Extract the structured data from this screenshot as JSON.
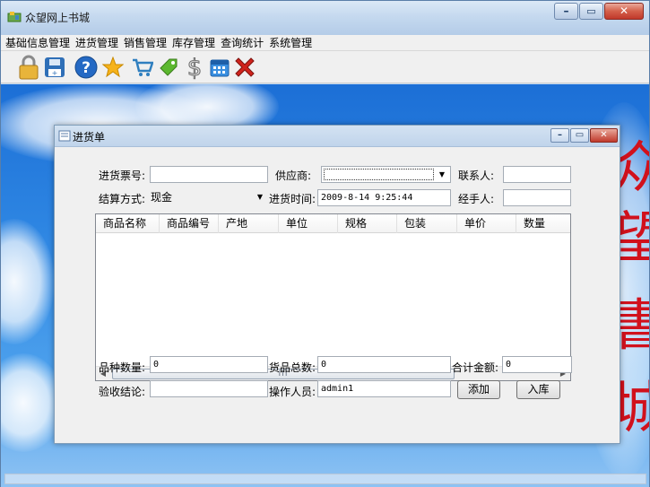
{
  "app": {
    "title": "众望网上书城"
  },
  "menu": [
    "基础信息管理",
    "进货管理",
    "销售管理",
    "库存管理",
    "查询统计",
    "系统管理"
  ],
  "toolbar_icons": [
    "lock-icon",
    "floppy-icon",
    "help-icon",
    "star-icon",
    "cart-icon",
    "tag-icon",
    "dollar-icon",
    "calendar-icon",
    "exit-icon"
  ],
  "brush_text": [
    "众",
    "望",
    "書",
    "城"
  ],
  "dialog": {
    "title": "进货单",
    "labels": {
      "ticket_no": "进货票号:",
      "supplier": "供应商:",
      "contact": "联系人:",
      "settlement": "结算方式:",
      "time": "进货时间:",
      "handler": "经手人:",
      "kinds": "品种数量:",
      "total_qty": "货品总数:",
      "total_amount": "合计金额:",
      "conclusion": "验收结论:",
      "operator": "操作人员:"
    },
    "values": {
      "ticket_no": "",
      "supplier": "",
      "contact": "",
      "settlement": "现金",
      "time": "2009-8-14 9:25:44",
      "handler": "",
      "kinds": "0",
      "total_qty": "0",
      "total_amount": "0",
      "conclusion": "",
      "operator": "admin1"
    },
    "columns": [
      "商品名称",
      "商品编号",
      "产地",
      "单位",
      "规格",
      "包装",
      "单价",
      "数量"
    ],
    "scroll_grip": "III",
    "buttons": {
      "add": "添加",
      "stock_in": "入库"
    }
  },
  "colors": {
    "brush_red": "#d1111c",
    "desktop_blue": "#2d85e2"
  }
}
